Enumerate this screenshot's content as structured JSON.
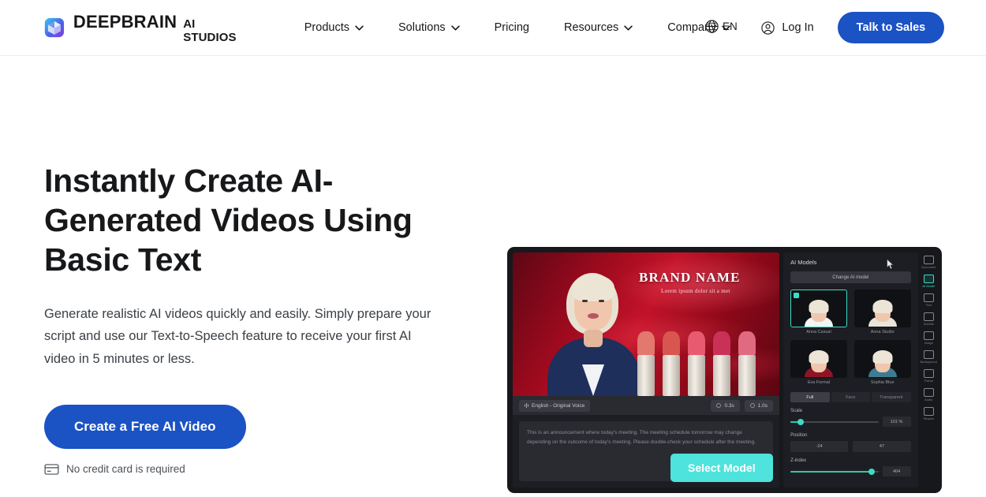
{
  "header": {
    "brand": {
      "name": "DEEPBRAIN",
      "sub": "AI STUDIOS",
      "logo_icon": "cube-logo-icon"
    },
    "nav": [
      {
        "label": "Products",
        "has_dropdown": true
      },
      {
        "label": "Solutions",
        "has_dropdown": true
      },
      {
        "label": "Pricing",
        "has_dropdown": false
      },
      {
        "label": "Resources",
        "has_dropdown": true
      },
      {
        "label": "Company",
        "has_dropdown": true
      }
    ],
    "language": {
      "label": "EN",
      "icon": "globe-icon"
    },
    "login": {
      "label": "Log In",
      "icon": "user-circle-icon"
    },
    "cta": {
      "label": "Talk to Sales",
      "color": "#1b52c4"
    }
  },
  "hero": {
    "title": "Instantly Create AI-Generated Videos Using Basic Text",
    "subtitle": "Generate realistic AI videos quickly and easily. Simply prepare your script and use our Text-to-Speech feature to receive your first AI video in 5 minutes or less.",
    "cta": {
      "label": "Create a Free AI Video",
      "color": "#1b52c4"
    },
    "note": {
      "label": "No credit card is required",
      "icon": "credit-card-icon"
    }
  },
  "app_preview": {
    "stage": {
      "brand_title": "BRAND NAME",
      "brand_subtitle": "Lorem ipsum dolor sit a met"
    },
    "toolbar": {
      "voice_pill": "English - Original Voice",
      "duration_pill": "0.3s",
      "length_pill": "1.0s"
    },
    "script_text": "This is an announcement where today's meeting. The meeting schedule tomorrow may change depending on the outcome of today's meeting. Please double-check your schedule after the meeting.",
    "inspector": {
      "title": "AI Models",
      "change_button": "Change AI model",
      "models": [
        {
          "name": "Anna Casual",
          "selected": true,
          "top": "#f2f3f5"
        },
        {
          "name": "Anna Studio",
          "selected": false,
          "top": "#e8e4dc"
        },
        {
          "name": "Eva Formal",
          "selected": false,
          "top": "#8d1626"
        },
        {
          "name": "Sophia Blue",
          "selected": false,
          "top": "#3e7b93"
        }
      ],
      "tabs": [
        {
          "label": "Full",
          "active": true
        },
        {
          "label": "Face",
          "active": false
        },
        {
          "label": "Transparent",
          "active": false
        }
      ],
      "scale": {
        "label": "Scale",
        "value": "101 %",
        "percent": 12
      },
      "position": {
        "label": "Position",
        "x": "-24",
        "y": "47"
      },
      "zindex": {
        "label": "Z-index",
        "value": "404",
        "percent": 92
      }
    },
    "rail": [
      {
        "label": "Document",
        "active": false
      },
      {
        "label": "AI Model",
        "active": true
      },
      {
        "label": "Text",
        "active": false
      },
      {
        "label": "Subtitle",
        "active": false
      },
      {
        "label": "Image",
        "active": false
      },
      {
        "label": "Background",
        "active": false
      },
      {
        "label": "Frame",
        "active": false
      },
      {
        "label": "Audio",
        "active": false
      },
      {
        "label": "Shapes",
        "active": false
      }
    ],
    "select_model_button": {
      "label": "Select Model",
      "color": "#4ee3dc"
    }
  }
}
